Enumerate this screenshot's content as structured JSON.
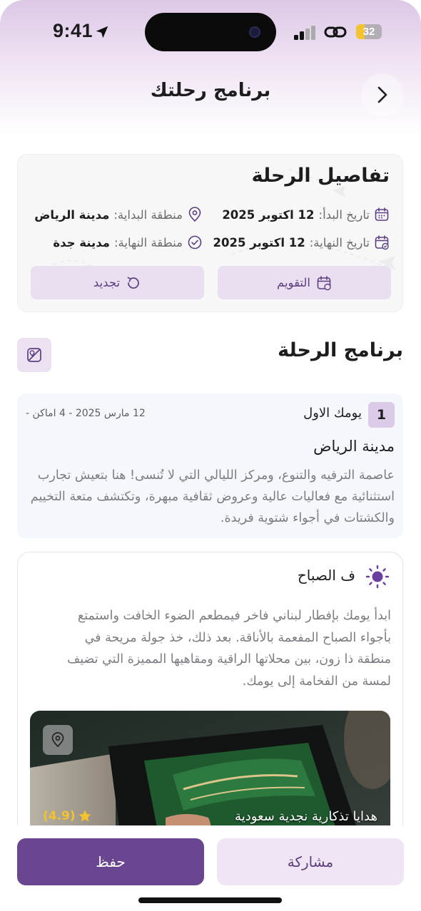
{
  "status_bar": {
    "time": "9:41",
    "battery": "32",
    "battery_level": 0.32
  },
  "header": {
    "title": "برنامج رحلتك"
  },
  "trip_details": {
    "title": "تفاصيل الرحلة",
    "start_date_label": "تاريخ البدأ:",
    "start_date_value": "12 اكتوبر 2025",
    "end_date_label": "تاريخ النهاية:",
    "end_date_value": "12 اكتوبر 2025",
    "start_region_label": "منطقة البداية:",
    "start_region_value": "مدينة الرياض",
    "end_region_label": "منطقة النهاية:",
    "end_region_value": "مدينة جدة",
    "calendar_button": "التقويم",
    "renew_button": "تجديد"
  },
  "program": {
    "title": "برنامج الرحلة"
  },
  "day": {
    "number": "1",
    "label": "يومك الاول",
    "meta": "12 مارس 2025  - 4 اماكن -",
    "city": "مدينة الرياض",
    "description": "عاصمة الترفيه والتنوع، ومركز الليالي التي لا تُنسى! هنا بتعيش تجارب استثنائية مع فعاليات عالية وعروض ثقافية مبهرة، وتكتشف متعة التخييم والكشتات في أجواء شتوية فريدة."
  },
  "period": {
    "title": "ف الصباح",
    "description": "ابدأ يومك بإفطار لبناني فاخر فيمطعم الضوء الخافت واستمتع بأجواء الصباح المفعمة بالأناقة. بعد ذلك، خذ جولة مريحة في منطقة ذا زون، بين محلاتها الراقية ومقاهيها المميزة التي تضيف لمسة من الفخامة إلى يومك.",
    "place": {
      "name": "هدايا تذكارية نجدية سعودية",
      "rating": "(4.9)"
    }
  },
  "actions": {
    "share_label": "مشاركة",
    "save_label": "حفظ"
  },
  "colors": {
    "primary": "#6b4690",
    "primary_soft": "#efe5f4",
    "accent_star": "#f3c22d"
  },
  "icons": {
    "back": "chevron-right-icon",
    "calendar": "calendar-icon",
    "location": "location-pin-icon",
    "check": "check-circle-icon",
    "refresh": "refresh-icon",
    "map": "map-icon",
    "sun": "sun-icon",
    "star": "star-icon"
  }
}
